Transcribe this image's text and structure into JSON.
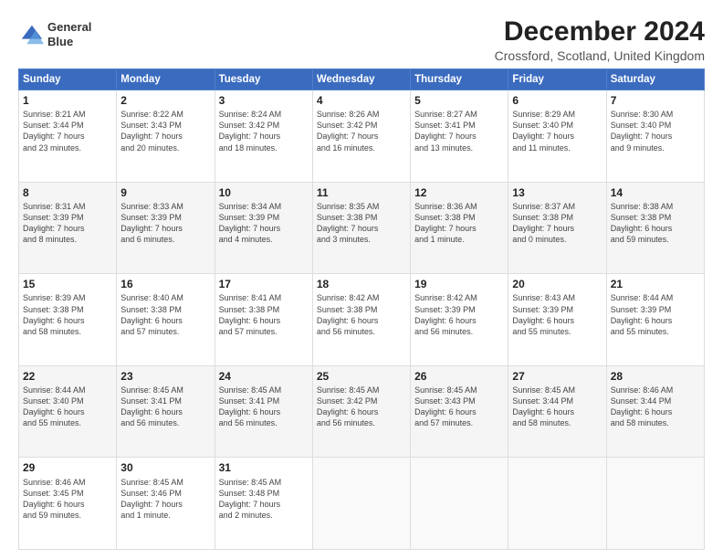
{
  "logo": {
    "line1": "General",
    "line2": "Blue"
  },
  "title": "December 2024",
  "subtitle": "Crossford, Scotland, United Kingdom",
  "weekdays": [
    "Sunday",
    "Monday",
    "Tuesday",
    "Wednesday",
    "Thursday",
    "Friday",
    "Saturday"
  ],
  "weeks": [
    [
      {
        "day": "1",
        "info": "Sunrise: 8:21 AM\nSunset: 3:44 PM\nDaylight: 7 hours\nand 23 minutes."
      },
      {
        "day": "2",
        "info": "Sunrise: 8:22 AM\nSunset: 3:43 PM\nDaylight: 7 hours\nand 20 minutes."
      },
      {
        "day": "3",
        "info": "Sunrise: 8:24 AM\nSunset: 3:42 PM\nDaylight: 7 hours\nand 18 minutes."
      },
      {
        "day": "4",
        "info": "Sunrise: 8:26 AM\nSunset: 3:42 PM\nDaylight: 7 hours\nand 16 minutes."
      },
      {
        "day": "5",
        "info": "Sunrise: 8:27 AM\nSunset: 3:41 PM\nDaylight: 7 hours\nand 13 minutes."
      },
      {
        "day": "6",
        "info": "Sunrise: 8:29 AM\nSunset: 3:40 PM\nDaylight: 7 hours\nand 11 minutes."
      },
      {
        "day": "7",
        "info": "Sunrise: 8:30 AM\nSunset: 3:40 PM\nDaylight: 7 hours\nand 9 minutes."
      }
    ],
    [
      {
        "day": "8",
        "info": "Sunrise: 8:31 AM\nSunset: 3:39 PM\nDaylight: 7 hours\nand 8 minutes."
      },
      {
        "day": "9",
        "info": "Sunrise: 8:33 AM\nSunset: 3:39 PM\nDaylight: 7 hours\nand 6 minutes."
      },
      {
        "day": "10",
        "info": "Sunrise: 8:34 AM\nSunset: 3:39 PM\nDaylight: 7 hours\nand 4 minutes."
      },
      {
        "day": "11",
        "info": "Sunrise: 8:35 AM\nSunset: 3:38 PM\nDaylight: 7 hours\nand 3 minutes."
      },
      {
        "day": "12",
        "info": "Sunrise: 8:36 AM\nSunset: 3:38 PM\nDaylight: 7 hours\nand 1 minute."
      },
      {
        "day": "13",
        "info": "Sunrise: 8:37 AM\nSunset: 3:38 PM\nDaylight: 7 hours\nand 0 minutes."
      },
      {
        "day": "14",
        "info": "Sunrise: 8:38 AM\nSunset: 3:38 PM\nDaylight: 6 hours\nand 59 minutes."
      }
    ],
    [
      {
        "day": "15",
        "info": "Sunrise: 8:39 AM\nSunset: 3:38 PM\nDaylight: 6 hours\nand 58 minutes."
      },
      {
        "day": "16",
        "info": "Sunrise: 8:40 AM\nSunset: 3:38 PM\nDaylight: 6 hours\nand 57 minutes."
      },
      {
        "day": "17",
        "info": "Sunrise: 8:41 AM\nSunset: 3:38 PM\nDaylight: 6 hours\nand 57 minutes."
      },
      {
        "day": "18",
        "info": "Sunrise: 8:42 AM\nSunset: 3:38 PM\nDaylight: 6 hours\nand 56 minutes."
      },
      {
        "day": "19",
        "info": "Sunrise: 8:42 AM\nSunset: 3:39 PM\nDaylight: 6 hours\nand 56 minutes."
      },
      {
        "day": "20",
        "info": "Sunrise: 8:43 AM\nSunset: 3:39 PM\nDaylight: 6 hours\nand 55 minutes."
      },
      {
        "day": "21",
        "info": "Sunrise: 8:44 AM\nSunset: 3:39 PM\nDaylight: 6 hours\nand 55 minutes."
      }
    ],
    [
      {
        "day": "22",
        "info": "Sunrise: 8:44 AM\nSunset: 3:40 PM\nDaylight: 6 hours\nand 55 minutes."
      },
      {
        "day": "23",
        "info": "Sunrise: 8:45 AM\nSunset: 3:41 PM\nDaylight: 6 hours\nand 56 minutes."
      },
      {
        "day": "24",
        "info": "Sunrise: 8:45 AM\nSunset: 3:41 PM\nDaylight: 6 hours\nand 56 minutes."
      },
      {
        "day": "25",
        "info": "Sunrise: 8:45 AM\nSunset: 3:42 PM\nDaylight: 6 hours\nand 56 minutes."
      },
      {
        "day": "26",
        "info": "Sunrise: 8:45 AM\nSunset: 3:43 PM\nDaylight: 6 hours\nand 57 minutes."
      },
      {
        "day": "27",
        "info": "Sunrise: 8:45 AM\nSunset: 3:44 PM\nDaylight: 6 hours\nand 58 minutes."
      },
      {
        "day": "28",
        "info": "Sunrise: 8:46 AM\nSunset: 3:44 PM\nDaylight: 6 hours\nand 58 minutes."
      }
    ],
    [
      {
        "day": "29",
        "info": "Sunrise: 8:46 AM\nSunset: 3:45 PM\nDaylight: 6 hours\nand 59 minutes."
      },
      {
        "day": "30",
        "info": "Sunrise: 8:45 AM\nSunset: 3:46 PM\nDaylight: 7 hours\nand 1 minute."
      },
      {
        "day": "31",
        "info": "Sunrise: 8:45 AM\nSunset: 3:48 PM\nDaylight: 7 hours\nand 2 minutes."
      },
      null,
      null,
      null,
      null
    ]
  ]
}
